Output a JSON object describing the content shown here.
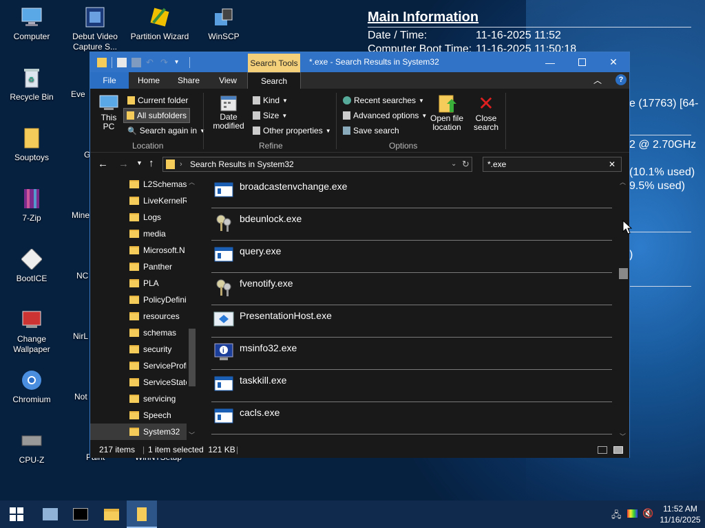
{
  "desktop": {
    "icons": [
      {
        "label": "Computer",
        "icon": "computer-icon"
      },
      {
        "label": "Recycle Bin",
        "icon": "recycle-bin-icon"
      },
      {
        "label": "Souptoys",
        "icon": "folder-icon"
      },
      {
        "label": "7-Zip",
        "icon": "7zip-icon"
      },
      {
        "label": "BootICE",
        "icon": "bootice-icon"
      },
      {
        "label": "Change Wallpaper",
        "icon": "wallpaper-icon"
      },
      {
        "label": "Chromium",
        "icon": "chromium-icon"
      },
      {
        "label": "CPU-Z",
        "icon": "cpuz-icon"
      },
      {
        "label": "Debut Video Capture S...",
        "icon": "video-capture-icon"
      },
      {
        "label": "Partition Wizard",
        "icon": "partition-wizard-icon"
      },
      {
        "label": "WinSCP",
        "icon": "winscp-icon"
      },
      {
        "label": "Eve",
        "icon": "app-icon"
      },
      {
        "label": "G",
        "icon": "app-icon"
      },
      {
        "label": "Mine",
        "icon": "app-icon"
      },
      {
        "label": "NC",
        "icon": "app-icon"
      },
      {
        "label": "NirL",
        "icon": "app-icon"
      },
      {
        "label": "Not",
        "icon": "app-icon"
      },
      {
        "label": "Paint",
        "icon": "app-icon"
      },
      {
        "label": "WinNTSetup",
        "icon": "app-icon"
      }
    ]
  },
  "info": {
    "title": "Main Information",
    "rows": [
      {
        "k": "Date / Time:",
        "v": "11-16-2025 11:52"
      },
      {
        "k": "Computer Boot Time:",
        "v": "11-16-2025 11:50:18"
      }
    ],
    "fragments": [
      "e (17763) [64-",
      "2 @ 2.70GHz",
      "(10.1% used)",
      "9.5% used)",
      ")"
    ]
  },
  "window": {
    "context_tab": "Search Tools",
    "title": "*.exe - Search Results in System32",
    "tabs": [
      "File",
      "Home",
      "Share",
      "View",
      "Search"
    ],
    "ribbon": {
      "location": {
        "this_pc": "This PC",
        "current_folder": "Current folder",
        "all_subfolders": "All subfolders",
        "search_again": "Search again in",
        "group": "Location"
      },
      "refine": {
        "date_modified": "Date modified",
        "kind": "Kind",
        "size": "Size",
        "other_properties": "Other properties",
        "group": "Refine"
      },
      "options": {
        "recent_searches": "Recent searches",
        "advanced_options": "Advanced options",
        "save_search": "Save search",
        "open_file_location": "Open file location",
        "close_search": "Close search",
        "group": "Options"
      }
    },
    "address": "Search Results in System32",
    "search_value": "*.exe",
    "nav_items": [
      "L2Schemas",
      "LiveKernelR",
      "Logs",
      "media",
      "Microsoft.N",
      "Panther",
      "PLA",
      "PolicyDefini",
      "resources",
      "schemas",
      "security",
      "ServiceProfi",
      "ServiceState",
      "servicing",
      "Speech",
      "System32"
    ],
    "results": [
      {
        "name": "broadcastenvchange.exe",
        "icon": "exe-window-icon"
      },
      {
        "name": "bdeunlock.exe",
        "icon": "bitlocker-keys-icon"
      },
      {
        "name": "query.exe",
        "icon": "exe-window-icon"
      },
      {
        "name": "fvenotify.exe",
        "icon": "bitlocker-keys-icon"
      },
      {
        "name": "PresentationHost.exe",
        "icon": "presentation-host-icon"
      },
      {
        "name": "msinfo32.exe",
        "icon": "msinfo-icon"
      },
      {
        "name": "taskkill.exe",
        "icon": "exe-window-icon"
      },
      {
        "name": "cacls.exe",
        "icon": "exe-window-icon"
      }
    ],
    "status": {
      "items": "217 items",
      "selected": "1 item selected  121 KB"
    }
  },
  "taskbar": {
    "time": "11:52 AM",
    "date": "11/16/2025"
  }
}
